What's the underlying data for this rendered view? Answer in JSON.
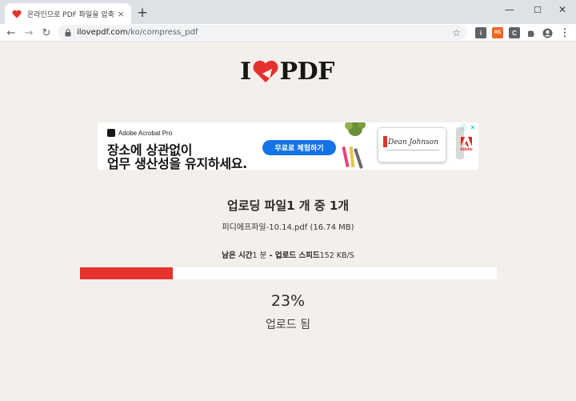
{
  "browser": {
    "tab_title": "온라인으로 PDF 파일을 압축하기",
    "url_host": "ilovepdf.com",
    "url_path": "/ko/compress_pdf",
    "tab_close": "×",
    "new_tab": "+",
    "min": "—",
    "max": "☐",
    "close": "✕",
    "back": "←",
    "forward": "→",
    "reload": "↻",
    "bookmark": "☆",
    "menu": "⋮",
    "extensions": [
      {
        "name": "ext-i",
        "label": "i",
        "color": "#5f6368"
      },
      {
        "name": "ext-rss",
        "label": "RS",
        "color": "#f26522"
      },
      {
        "name": "ext-c",
        "label": "C",
        "color": "#5f6368"
      }
    ]
  },
  "site": {
    "logo_left": "I",
    "logo_right": "PDF",
    "brand_color": "#e5322d"
  },
  "ad": {
    "brand": "Adobe Acrobat Pro",
    "line1": "장소에 상관없이",
    "line2": "업무 생산성을 유지하세요.",
    "cta": "무료로 체험하기",
    "signature": "Dean Johnson",
    "adobe_label": "Adobe",
    "info": "ⓘ",
    "close": "✕"
  },
  "upload": {
    "title": "업로딩 파일1 개 중 1개",
    "file": "피디에프파일-10.14.pdf (16.74 MB)",
    "remaining_label": "남은 시간",
    "remaining_value": "1 분",
    "separator": " - ",
    "speed_label": "업로드 스피드",
    "speed_value": "152 KB/S",
    "progress": 0.23,
    "percent_text": "23%",
    "status": "업로드 됨"
  }
}
